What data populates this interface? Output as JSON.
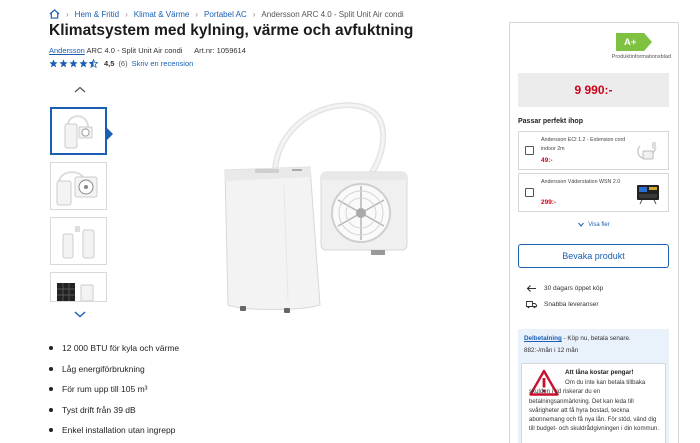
{
  "breadcrumb": {
    "items": [
      "Hem & Fritid",
      "Klimat & Värme",
      "Portabel AC"
    ],
    "current": "Andersson ARC 4.0 - Split Unit Air condi",
    "separator": "›"
  },
  "product": {
    "title": "Klimatsystem med kylning, värme och avfuktning",
    "brand": "Andersson",
    "model": "ARC 4.0 - Split Unit Air condi",
    "artnr_label": "Art.nr: 1059614",
    "rating": {
      "stars": 4.5,
      "score": "4,5",
      "count": "(6)",
      "review_link": "Skriv en recension"
    }
  },
  "gallery": {
    "thumb_count": 4,
    "active_index": 0,
    "up_icon": "chevron-up-icon",
    "down_icon": "chevron-down-icon"
  },
  "features": [
    "12 000 BTU för kyla och värme",
    "Låg energiförbrukning",
    "För rum upp till 105 m³",
    "Tyst drift från 39 dB",
    "Enkel installation utan ingrepp"
  ],
  "sidebar": {
    "energy_class": "A+",
    "energy_label": "Produktinformationsblad",
    "price": "9 990:-",
    "accessories_title": "Passar perfekt ihop",
    "accessories": [
      {
        "name": "Andersson ECI 1.2 - Extension cord indoor 2m",
        "price": "49:-"
      },
      {
        "name": "Andersson Väderstation WSN 2.0",
        "price": "299:-"
      }
    ],
    "more_label": "Visa fler",
    "watch_button": "Bevaka produkt",
    "perks": [
      "30 dagars öppet köp",
      "Snabba leveranser"
    ],
    "finance": {
      "link": "Delbetalning",
      "text": " - Köp nu, betala senare.",
      "monthly": "882:-/mån i 12 mån",
      "warning_title": "Att låna kostar pengar!",
      "warning_body": "Om du inte kan betala tillbaka skulden i tid riskerar du en betalningsanmärkning. Det kan leda till svårigheter att få hyra bostad, teckna abonnemang och få nya lån. För stöd, vänd dig till budget- och skuldrådgivningen i din kommun."
    }
  },
  "colors": {
    "link": "#1a5fb4",
    "price": "#d0021b",
    "energy": "#7fc242",
    "warning": "#c8102e"
  }
}
